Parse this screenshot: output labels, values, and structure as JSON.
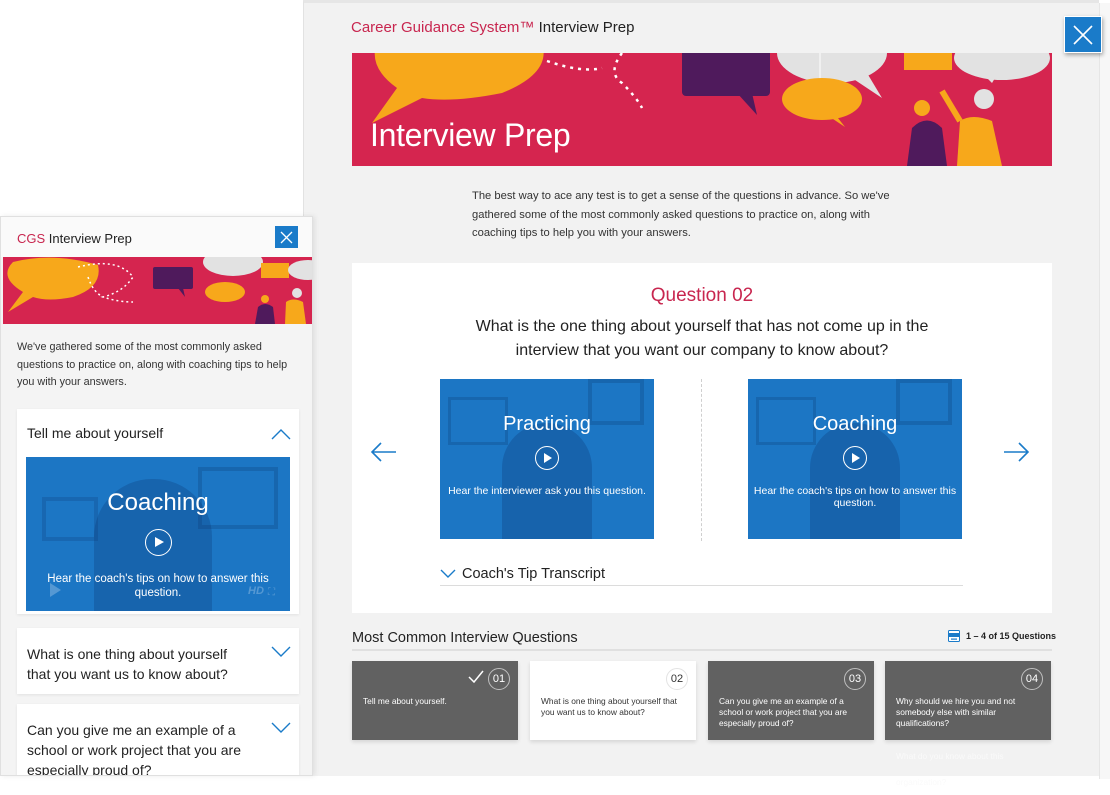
{
  "desktop": {
    "title_brand": "Career Guidance System™",
    "title_rest": "Interview Prep",
    "close_icon": "close-icon",
    "hero_title": "Interview Prep",
    "intro": "The best way to ace any test is to get a sense of the questions in advance. So we've gathered some of the most commonly asked questions to practice on, along with coaching tips to help you with your answers.",
    "question": {
      "number_label": "Question 02",
      "text": "What is the one thing about yourself that has not come up in the interview that you want our company to know about?",
      "prev_icon": "arrow-left-icon",
      "next_icon": "arrow-right-icon",
      "videos": [
        {
          "title": "Practicing",
          "subtitle": "Hear the interviewer ask you this question."
        },
        {
          "title": "Coaching",
          "subtitle": "Hear the coach's tips on how to answer this question."
        }
      ],
      "transcript_label": "Coach's Tip Transcript"
    },
    "most_common": {
      "title": "Most Common Interview Questions",
      "count_label": "1 – 4 of 15 Questions",
      "count_icon": "pdf-icon",
      "tiles": [
        {
          "num": "01",
          "text": "Tell me about yourself.",
          "completed": true,
          "active": false
        },
        {
          "num": "02",
          "text": "What is one thing about yourself that you want us to know about?",
          "completed": false,
          "active": true
        },
        {
          "num": "03",
          "text": "Can you give me an example of a school or work project that you are especially proud of?",
          "completed": false,
          "active": false
        },
        {
          "num": "04",
          "text": "Why should we hire you and not somebody else with similar qualifications?",
          "completed": false,
          "active": false
        }
      ],
      "overflow_text": "What do you know about this organization?"
    },
    "colors": {
      "brand": "#c8264f",
      "accent": "#1a7bc9",
      "hero": "#d5254f",
      "tile": "#616161"
    }
  },
  "mobile": {
    "title_brand": "CGS",
    "title_rest": "Interview Prep",
    "intro": "We've gathered some of the most commonly asked questions to practice on, along with coaching tips to help you with your answers.",
    "accordion": [
      {
        "question": "Tell me about yourself",
        "expanded": true,
        "video": {
          "title": "Coaching",
          "subtitle": "Hear the coach's tips on how to answer this question.",
          "hd_label": "HD"
        }
      },
      {
        "question": "What is one thing about yourself that you want us to know about?",
        "expanded": false
      },
      {
        "question": "Can you give me an example of a school or work project that you are especially proud of?",
        "expanded": false
      }
    ]
  }
}
